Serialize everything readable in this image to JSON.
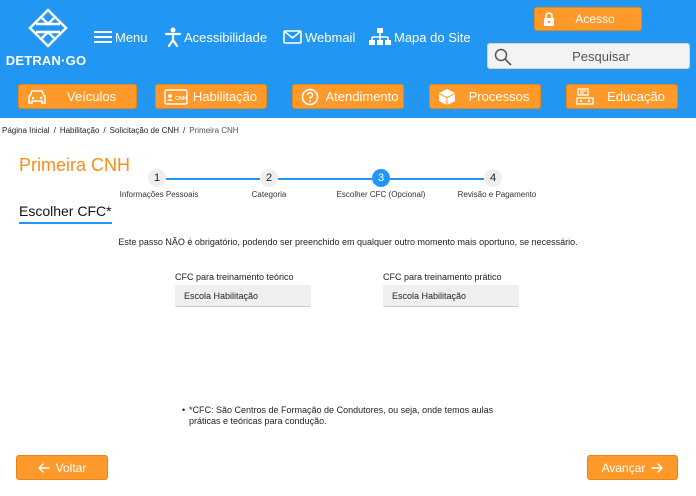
{
  "header": {
    "logo_text": "DETRAN·GO",
    "menu_label": "Menu",
    "accessibility_label": "Acessibilidade",
    "webmail_label": "Webmail",
    "sitemap_label": "Mapa do Site",
    "acesso_label": "Acesso",
    "search_placeholder": "Pesquisar"
  },
  "categories": [
    {
      "label": "Veículos",
      "icon": "car-icon"
    },
    {
      "label": "Habilitação",
      "icon": "cnh-card-icon"
    },
    {
      "label": "Atendimento",
      "icon": "help-circle-icon"
    },
    {
      "label": "Processos",
      "icon": "box-icon"
    },
    {
      "label": "Educação",
      "icon": "education-icon"
    }
  ],
  "breadcrumb": {
    "items": [
      "Página Inicial",
      "Habilitação",
      "Solicitação de CNH"
    ],
    "current": "Primeira CNH",
    "separator": "/"
  },
  "page": {
    "title": "Primeira CNH",
    "section_title": "Escolher CFC*",
    "info": "Este passo NÃO é obrigatório, podendo ser preenchido em qualquer outro momento mais oportuno, se necessário."
  },
  "steps": [
    {
      "number": "1",
      "label": "Informações Pessoais"
    },
    {
      "number": "2",
      "label": "Categoria"
    },
    {
      "number": "3",
      "label": "Escolher CFC (Opcional)"
    },
    {
      "number": "4",
      "label": "Revisão e Pagamento"
    }
  ],
  "active_step": 3,
  "fields": {
    "teorico_label": "CFC para treinamento teórico",
    "teorico_value": "Escola Habilitação",
    "pratico_label": "CFC para treinamento prático",
    "pratico_value": "Escola Habilitação"
  },
  "footnote": {
    "bullet": "•",
    "text": "*CFC: São Centros de Formação de Condutores, ou seja, onde temos aulas práticas e teóricas para condução."
  },
  "buttons": {
    "back_label": "Voltar",
    "next_label": "Avançar"
  },
  "colors": {
    "primary_blue": "#2196f3",
    "accent_orange": "#ff9a2a",
    "title_orange": "#ff8c1a"
  }
}
